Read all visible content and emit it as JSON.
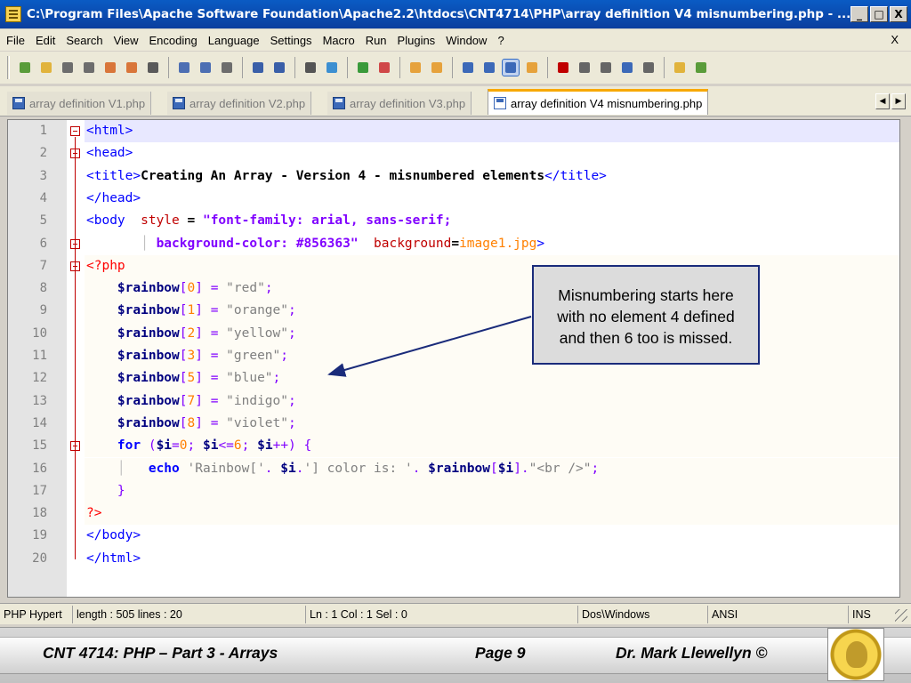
{
  "window": {
    "title": "C:\\Program Files\\Apache Software Foundation\\Apache2.2\\htdocs\\CNT4714\\PHP\\array definition V4 misnumbering.php - ...",
    "buttons": [
      "_",
      "□",
      "X"
    ]
  },
  "menu": {
    "items": [
      "File",
      "Edit",
      "Search",
      "View",
      "Encoding",
      "Language",
      "Settings",
      "Macro",
      "Run",
      "Plugins",
      "Window",
      "?"
    ],
    "close": "X"
  },
  "toolbar": {
    "icons": [
      "new-file-icon",
      "open-file-icon",
      "save-icon",
      "save-all-icon",
      "close-icon",
      "close-all-icon",
      "print-icon",
      "cut-icon",
      "copy-icon",
      "paste-icon",
      "undo-icon",
      "redo-icon",
      "find-icon",
      "replace-icon",
      "zoom-in-icon",
      "zoom-out-icon",
      "sync-v-icon",
      "sync-h-icon",
      "word-wrap-icon",
      "show-all-chars-icon",
      "indent-guide-icon",
      "folder-as-workspace-icon",
      "record-macro-icon",
      "stop-macro-icon",
      "play-macro-icon",
      "run-macro-multiple-icon",
      "save-macro-icon",
      "open-folder-icon",
      "spellcheck-icon"
    ],
    "accent": "#316ac5"
  },
  "tabs": [
    {
      "label": "array definition V1.php",
      "active": false
    },
    {
      "label": "array definition V2.php",
      "active": false
    },
    {
      "label": "array definition V3.php",
      "active": false
    },
    {
      "label": "array definition V4 misnumbering.php",
      "active": true
    }
  ],
  "editor": {
    "line_numbers": [
      "1",
      "2",
      "3",
      "4",
      "5",
      "6",
      "7",
      "8",
      "9",
      "10",
      "11",
      "12",
      "13",
      "14",
      "15",
      "16",
      "17",
      "18",
      "19",
      "20"
    ],
    "lines": [
      [
        {
          "c": "tag",
          "t": "<html>"
        }
      ],
      [
        {
          "c": "tag",
          "t": "<head>"
        }
      ],
      [
        {
          "c": "tag",
          "t": "<title>"
        },
        {
          "c": "txt",
          "t": "Creating An Array - Version 4 - misnumbered elements"
        },
        {
          "c": "tag",
          "t": "</title>"
        }
      ],
      [
        {
          "c": "tag",
          "t": "</head>"
        }
      ],
      [
        {
          "c": "tag",
          "t": "<body  "
        },
        {
          "c": "attr",
          "t": "style"
        },
        {
          "c": "txt",
          "t": " = "
        },
        {
          "c": "str",
          "t": "\"font-family: arial, sans-serif;"
        }
      ],
      [
        {
          "c": "indent-guide",
          "t": "       │ "
        },
        {
          "c": "str",
          "t": "background-color: #856363\"  "
        },
        {
          "c": "attr2",
          "t": "background"
        },
        {
          "c": "txt",
          "t": "="
        },
        {
          "c": "val",
          "t": "image1.jpg"
        },
        {
          "c": "tag",
          "t": ">"
        }
      ],
      [
        {
          "c": "php-tag",
          "t": "<?php"
        }
      ],
      [
        {
          "c": "var",
          "t": "    $rainbow"
        },
        {
          "c": "op",
          "t": "["
        },
        {
          "c": "num",
          "t": "0"
        },
        {
          "c": "op",
          "t": "] = "
        },
        {
          "c": "php-str",
          "t": "\"red\""
        },
        {
          "c": "op",
          "t": ";"
        }
      ],
      [
        {
          "c": "var",
          "t": "    $rainbow"
        },
        {
          "c": "op",
          "t": "["
        },
        {
          "c": "num",
          "t": "1"
        },
        {
          "c": "op",
          "t": "] = "
        },
        {
          "c": "php-str",
          "t": "\"orange\""
        },
        {
          "c": "op",
          "t": ";"
        }
      ],
      [
        {
          "c": "var",
          "t": "    $rainbow"
        },
        {
          "c": "op",
          "t": "["
        },
        {
          "c": "num",
          "t": "2"
        },
        {
          "c": "op",
          "t": "] = "
        },
        {
          "c": "php-str",
          "t": "\"yellow\""
        },
        {
          "c": "op",
          "t": ";"
        }
      ],
      [
        {
          "c": "var",
          "t": "    $rainbow"
        },
        {
          "c": "op",
          "t": "["
        },
        {
          "c": "num",
          "t": "3"
        },
        {
          "c": "op",
          "t": "] = "
        },
        {
          "c": "php-str",
          "t": "\"green\""
        },
        {
          "c": "op",
          "t": ";"
        }
      ],
      [
        {
          "c": "var",
          "t": "    $rainbow"
        },
        {
          "c": "op",
          "t": "["
        },
        {
          "c": "num",
          "t": "5"
        },
        {
          "c": "op",
          "t": "] = "
        },
        {
          "c": "php-str",
          "t": "\"blue\""
        },
        {
          "c": "op",
          "t": ";"
        }
      ],
      [
        {
          "c": "var",
          "t": "    $rainbow"
        },
        {
          "c": "op",
          "t": "["
        },
        {
          "c": "num",
          "t": "7"
        },
        {
          "c": "op",
          "t": "] = "
        },
        {
          "c": "php-str",
          "t": "\"indigo\""
        },
        {
          "c": "op",
          "t": ";"
        }
      ],
      [
        {
          "c": "var",
          "t": "    $rainbow"
        },
        {
          "c": "op",
          "t": "["
        },
        {
          "c": "num",
          "t": "8"
        },
        {
          "c": "op",
          "t": "] = "
        },
        {
          "c": "php-str",
          "t": "\"violet\""
        },
        {
          "c": "op",
          "t": ";"
        }
      ],
      [
        {
          "c": "kw",
          "t": "    for"
        },
        {
          "c": "op",
          "t": " ("
        },
        {
          "c": "var",
          "t": "$i"
        },
        {
          "c": "op",
          "t": "="
        },
        {
          "c": "num",
          "t": "0"
        },
        {
          "c": "op",
          "t": "; "
        },
        {
          "c": "var",
          "t": "$i"
        },
        {
          "c": "op",
          "t": "<="
        },
        {
          "c": "num",
          "t": "6"
        },
        {
          "c": "op",
          "t": "; "
        },
        {
          "c": "var",
          "t": "$i"
        },
        {
          "c": "op",
          "t": "++) {"
        }
      ],
      [
        {
          "c": "indent-guide",
          "t": "    │   "
        },
        {
          "c": "kw",
          "t": "echo"
        },
        {
          "c": "php-str",
          "t": " 'Rainbow['"
        },
        {
          "c": "op",
          "t": ". "
        },
        {
          "c": "var",
          "t": "$i"
        },
        {
          "c": "op",
          "t": "."
        },
        {
          "c": "php-str",
          "t": "'] color is: '"
        },
        {
          "c": "op",
          "t": ". "
        },
        {
          "c": "var",
          "t": "$rainbow"
        },
        {
          "c": "op",
          "t": "["
        },
        {
          "c": "var",
          "t": "$i"
        },
        {
          "c": "op",
          "t": "]."
        },
        {
          "c": "php-str",
          "t": "\"<br />\""
        },
        {
          "c": "op",
          "t": ";"
        }
      ],
      [
        {
          "c": "op",
          "t": "    }"
        }
      ],
      [
        {
          "c": "php-tag",
          "t": "?>"
        }
      ],
      [
        {
          "c": "tag",
          "t": "</body>"
        }
      ],
      [
        {
          "c": "tag",
          "t": "</html>"
        }
      ]
    ]
  },
  "callout": {
    "lines": [
      "Misnumbering starts here",
      "with no element 4 defined",
      "and then 6 too is missed."
    ]
  },
  "status": {
    "lang": "PHP Hypert",
    "length": "length : 505    lines : 20",
    "position": "Ln : 1    Col : 1    Sel : 0",
    "eol": "Dos\\Windows",
    "encoding": "ANSI",
    "mode": "INS"
  },
  "footer": {
    "course": "CNT 4714:  PHP – Part 3 - Arrays",
    "page": "Page 9",
    "author": "Dr. Mark Llewellyn ©"
  }
}
